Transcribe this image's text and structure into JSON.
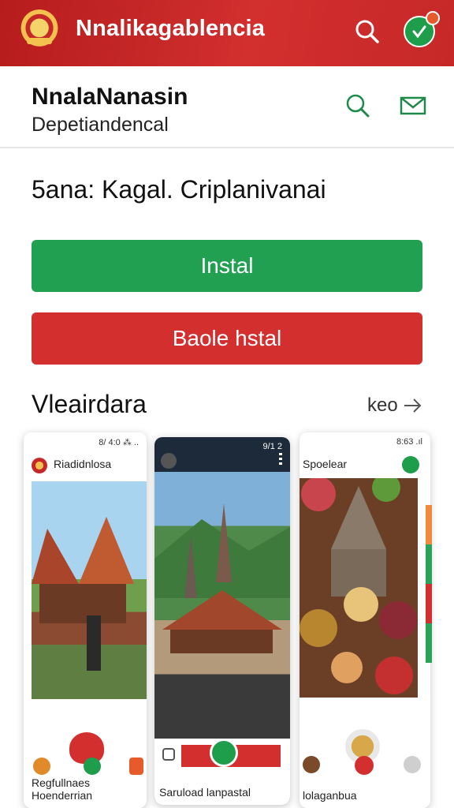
{
  "appbar": {
    "title": "Nnalikagablencia"
  },
  "developer": {
    "name": "NnalaNanasin",
    "dept": "Depetiandencal"
  },
  "app_subtitle": "5ana: Kagal. Criplanivanai",
  "buttons": {
    "install": "Instal",
    "beta_install": "Baole hstal"
  },
  "screenshots_section": {
    "title": "Vleairdara",
    "more_label": "keo"
  },
  "screenshots": [
    {
      "title": "Riadidnlosa",
      "status": "8/ 4:0 ⁂ ..",
      "label": "Regfullnaes Hoenderrian"
    },
    {
      "title": "",
      "status": "9/1 2",
      "label": "Saruload lanpastal"
    },
    {
      "title": "Spoelear",
      "status": "8:63 .ıl",
      "label": "lolaganbua"
    }
  ],
  "colors": {
    "primary_red": "#d32f2f",
    "primary_green": "#22a052"
  }
}
